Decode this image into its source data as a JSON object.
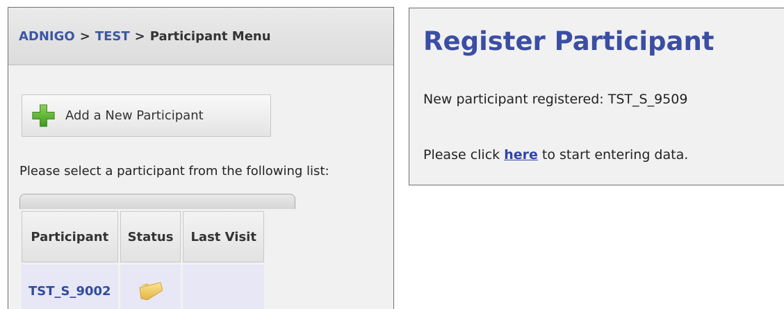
{
  "breadcrumb": {
    "items": [
      "ADNIGO",
      "TEST"
    ],
    "separator": ">",
    "current": "Participant Menu"
  },
  "add_button": {
    "label": "Add a New Participant",
    "icon": "plus-icon"
  },
  "instruction": "Please select a participant from the following list:",
  "table": {
    "headers": [
      "Participant",
      "Status",
      "Last Visit"
    ],
    "rows": [
      {
        "participant": "TST_S_9002",
        "status_icon": "folder-icon",
        "last_visit": ""
      }
    ]
  },
  "register": {
    "title": "Register Participant",
    "message": "New participant registered: TST_S_9509",
    "click_prefix": "Please click",
    "link_text": "here",
    "click_suffix": "to start entering data."
  },
  "colors": {
    "link_blue": "#3b57a4",
    "title_blue": "#3b4ea3",
    "row_highlight": "#e8e7f6",
    "panel_bg": "#f1f1f1"
  }
}
